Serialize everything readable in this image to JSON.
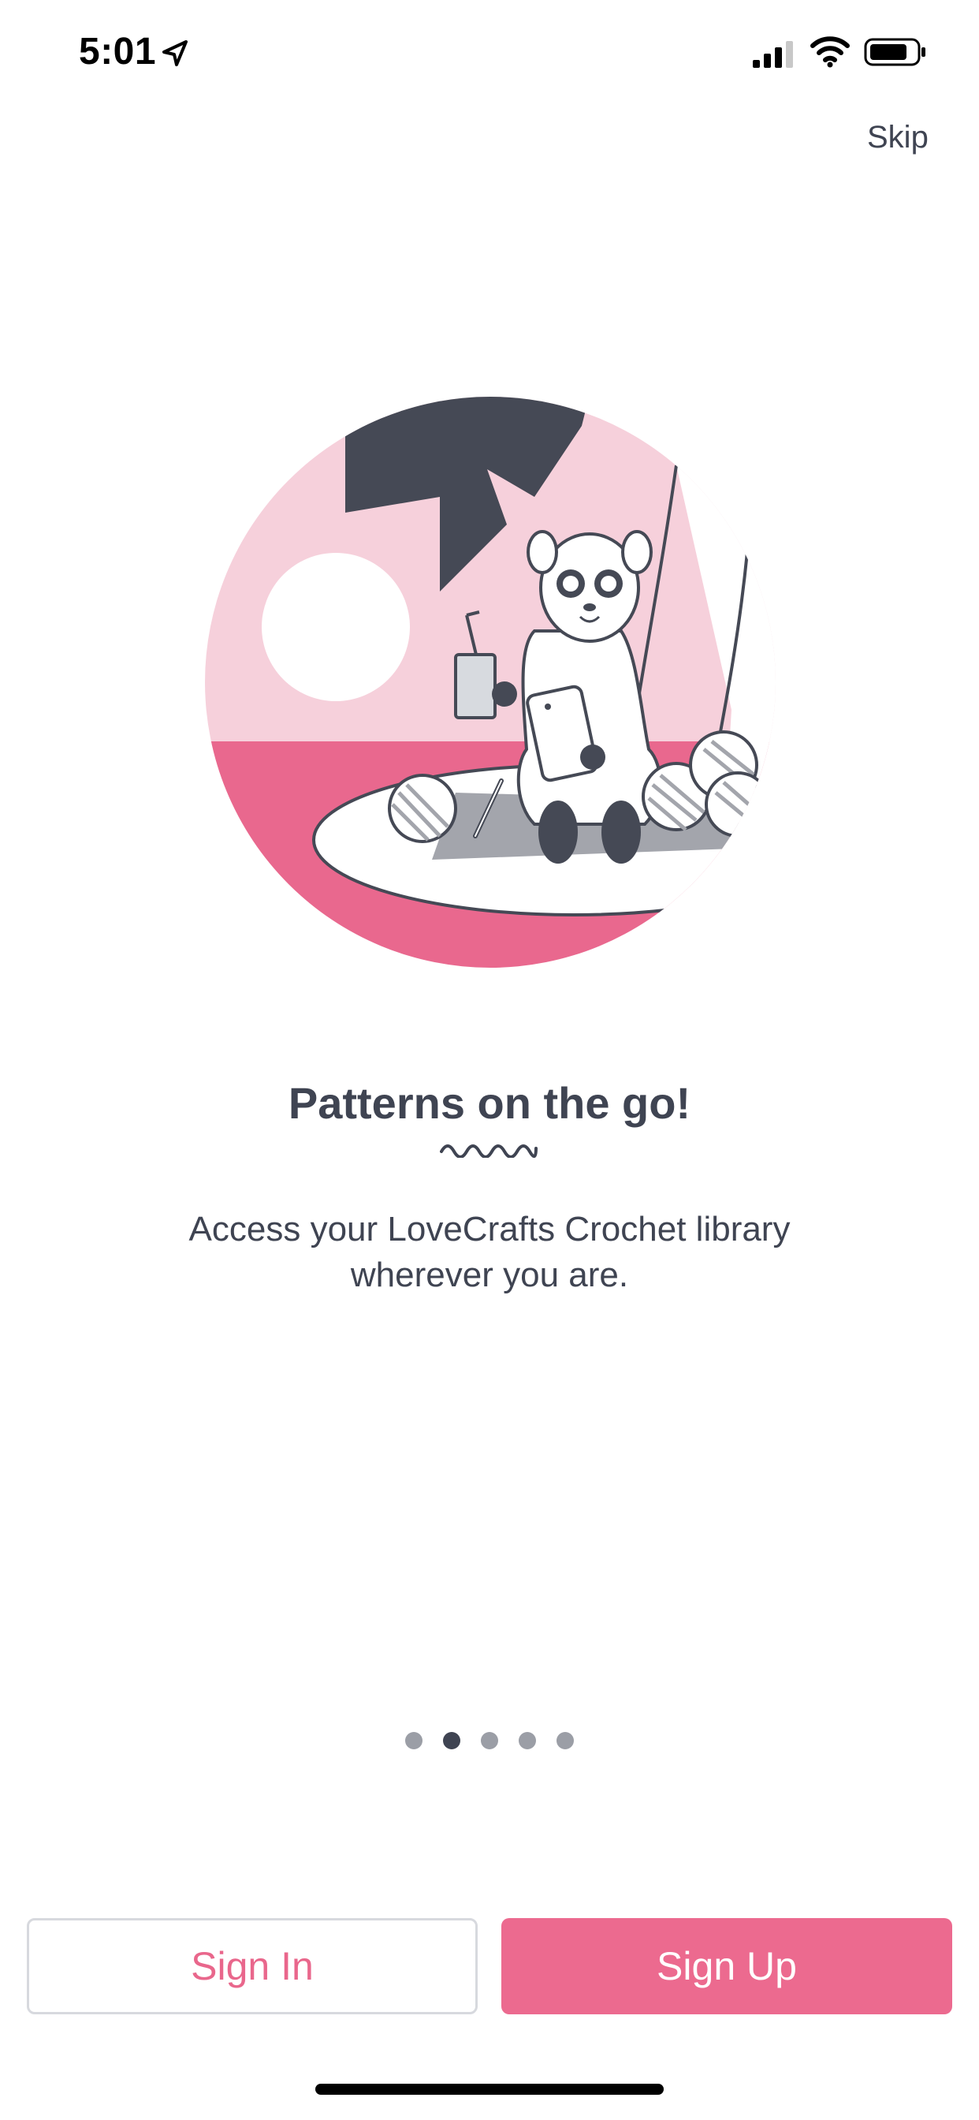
{
  "status_bar": {
    "time": "5:01",
    "icons": [
      "location-arrow-icon",
      "cellular-signal-icon",
      "wifi-icon",
      "battery-icon"
    ]
  },
  "header": {
    "skip_label": "Skip"
  },
  "illustration": {
    "subject": "llama-with-tablet-illustration"
  },
  "content": {
    "title": "Patterns on the go!",
    "subtitle": "Access your LoveCrafts Crochet library wherever you are."
  },
  "pager": {
    "total": 5,
    "active_index": 1
  },
  "actions": {
    "sign_in_label": "Sign In",
    "sign_up_label": "Sign Up"
  },
  "colors": {
    "accent": "#ec6a8f",
    "text": "#3f4452",
    "illustration_pink_light": "#f6d0db",
    "illustration_pink_dark": "#e9688e",
    "illustration_dark": "#454955"
  }
}
